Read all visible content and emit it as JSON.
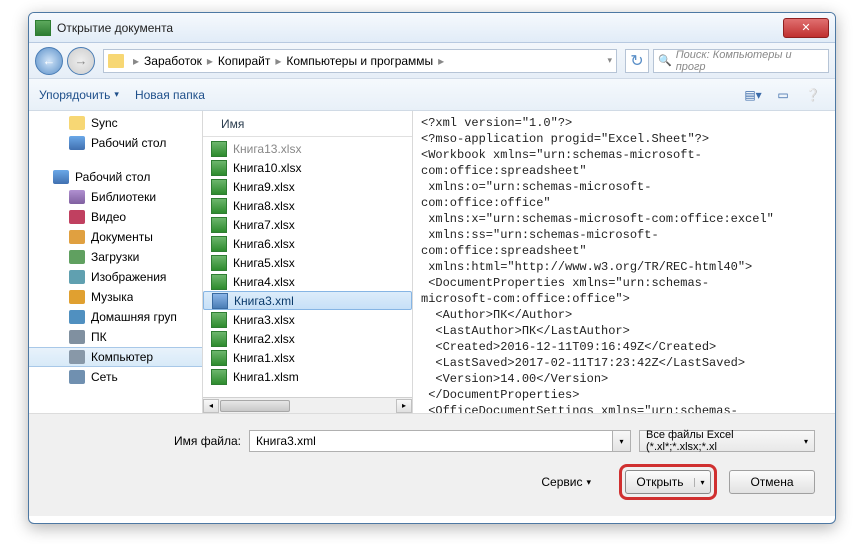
{
  "window": {
    "title": "Открытие документа"
  },
  "breadcrumb": {
    "items": [
      "Заработок",
      "Копирайт",
      "Компьютеры и программы"
    ],
    "sep": "▸"
  },
  "search": {
    "placeholder": "Поиск: Компьютеры и прогр"
  },
  "toolbar": {
    "organize": "Упорядочить",
    "newfolder": "Новая папка"
  },
  "tree": {
    "items": [
      {
        "label": "Sync",
        "ico": "ti-folder",
        "lvl": 2
      },
      {
        "label": "Рабочий стол",
        "ico": "ti-monitor",
        "lvl": 2
      },
      {
        "gap": true
      },
      {
        "label": "Рабочий стол",
        "ico": "ti-monitor",
        "lvl": 1
      },
      {
        "label": "Библиотеки",
        "ico": "ti-lib",
        "lvl": 2
      },
      {
        "label": "Видео",
        "ico": "ti-video",
        "lvl": 2
      },
      {
        "label": "Документы",
        "ico": "ti-doc",
        "lvl": 2
      },
      {
        "label": "Загрузки",
        "ico": "ti-dl",
        "lvl": 2
      },
      {
        "label": "Изображения",
        "ico": "ti-img",
        "lvl": 2
      },
      {
        "label": "Музыка",
        "ico": "ti-music",
        "lvl": 2
      },
      {
        "label": "Домашняя груп",
        "ico": "ti-group",
        "lvl": 2
      },
      {
        "label": "ПК",
        "ico": "ti-pc",
        "lvl": 2
      },
      {
        "label": "Компьютер",
        "ico": "ti-comp",
        "lvl": 2,
        "sel": true
      },
      {
        "label": "Сеть",
        "ico": "ti-net",
        "lvl": 2
      }
    ]
  },
  "filecol": "Имя",
  "files": [
    {
      "name": "Книга13.xlsx",
      "ico": "x",
      "cut": true
    },
    {
      "name": "Книга10.xlsx",
      "ico": "x"
    },
    {
      "name": "Книга9.xlsx",
      "ico": "x"
    },
    {
      "name": "Книга8.xlsx",
      "ico": "x"
    },
    {
      "name": "Книга7.xlsx",
      "ico": "x"
    },
    {
      "name": "Книга6.xlsx",
      "ico": "x"
    },
    {
      "name": "Книга5.xlsx",
      "ico": "x"
    },
    {
      "name": "Книга4.xlsx",
      "ico": "x"
    },
    {
      "name": "Книга3.xml",
      "ico": "m",
      "sel": true
    },
    {
      "name": "Книга3.xlsx",
      "ico": "x"
    },
    {
      "name": "Книга2.xlsx",
      "ico": "x"
    },
    {
      "name": "Книга1.xlsx",
      "ico": "x"
    },
    {
      "name": "Книга1.xlsm",
      "ico": "x"
    }
  ],
  "preview": "<?xml version=\"1.0\"?>\n<?mso-application progid=\"Excel.Sheet\"?>\n<Workbook xmlns=\"urn:schemas-microsoft-\ncom:office:spreadsheet\"\n xmlns:o=\"urn:schemas-microsoft-\ncom:office:office\"\n xmlns:x=\"urn:schemas-microsoft-com:office:excel\"\n xmlns:ss=\"urn:schemas-microsoft-\ncom:office:spreadsheet\"\n xmlns:html=\"http://www.w3.org/TR/REC-html40\">\n <DocumentProperties xmlns=\"urn:schemas-\nmicrosoft-com:office:office\">\n  <Author>ПК</Author>\n  <LastAuthor>ПК</LastAuthor>\n  <Created>2016-12-11T09:16:49Z</Created>\n  <LastSaved>2017-02-11T17:23:42Z</LastSaved>\n  <Version>14.00</Version>\n </DocumentProperties>\n <OfficeDocumentSettings xmlns=\"urn:schemas-\nmicrosoft-com:office:office\">\n  <AllowPNG/>\n </OfficeDocumentSettings>\n <ExcelWorkbook xmlns=\"urn:schemas-microsoft-",
  "bottom": {
    "fnamelabel": "Имя файла:",
    "fname": "Книга3.xml",
    "ftype": "Все файлы Excel (*.xl*;*.xlsx;*.xl",
    "service": "Сервис",
    "open": "Открыть",
    "cancel": "Отмена"
  }
}
